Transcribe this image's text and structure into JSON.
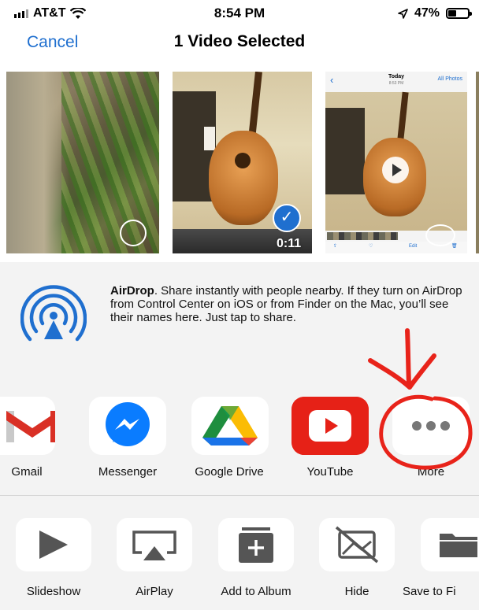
{
  "status_bar": {
    "carrier": "AT&T",
    "time": "8:54 PM",
    "battery": "47%",
    "battery_level": 0.47
  },
  "header": {
    "cancel": "Cancel",
    "title": "1 Video Selected"
  },
  "thumbnails": {
    "video_duration": "0:11",
    "screenshot_today": "Today",
    "screenshot_time": "8:53 PM",
    "screenshot_all_photos": "All Photos",
    "screenshot_edit": "Edit"
  },
  "airdrop": {
    "title": "AirDrop",
    "description": ". Share instantly with people nearby. If they turn on AirDrop from Control Center on iOS or from Finder on the Mac, you’ll see their names here. Just tap to share."
  },
  "apps": [
    {
      "label": "Gmail",
      "icon": "gmail-icon"
    },
    {
      "label": "Messenger",
      "icon": "messenger-icon"
    },
    {
      "label": "Google Drive",
      "icon": "google-drive-icon"
    },
    {
      "label": "YouTube",
      "icon": "youtube-icon"
    },
    {
      "label": "More",
      "icon": "more-icon"
    }
  ],
  "actions": [
    {
      "label": "Slideshow",
      "icon": "play-icon"
    },
    {
      "label": "AirPlay",
      "icon": "airplay-icon"
    },
    {
      "label": "Add to Album",
      "icon": "add-to-album-icon"
    },
    {
      "label": "Hide",
      "icon": "hide-icon"
    },
    {
      "label": "Save to Fi",
      "icon": "folder-icon"
    }
  ],
  "colors": {
    "ios_blue": "#1f6fcf",
    "annotation_red": "#e8231a",
    "youtube_red": "#e62117",
    "messenger_blue": "#0a7cff"
  }
}
